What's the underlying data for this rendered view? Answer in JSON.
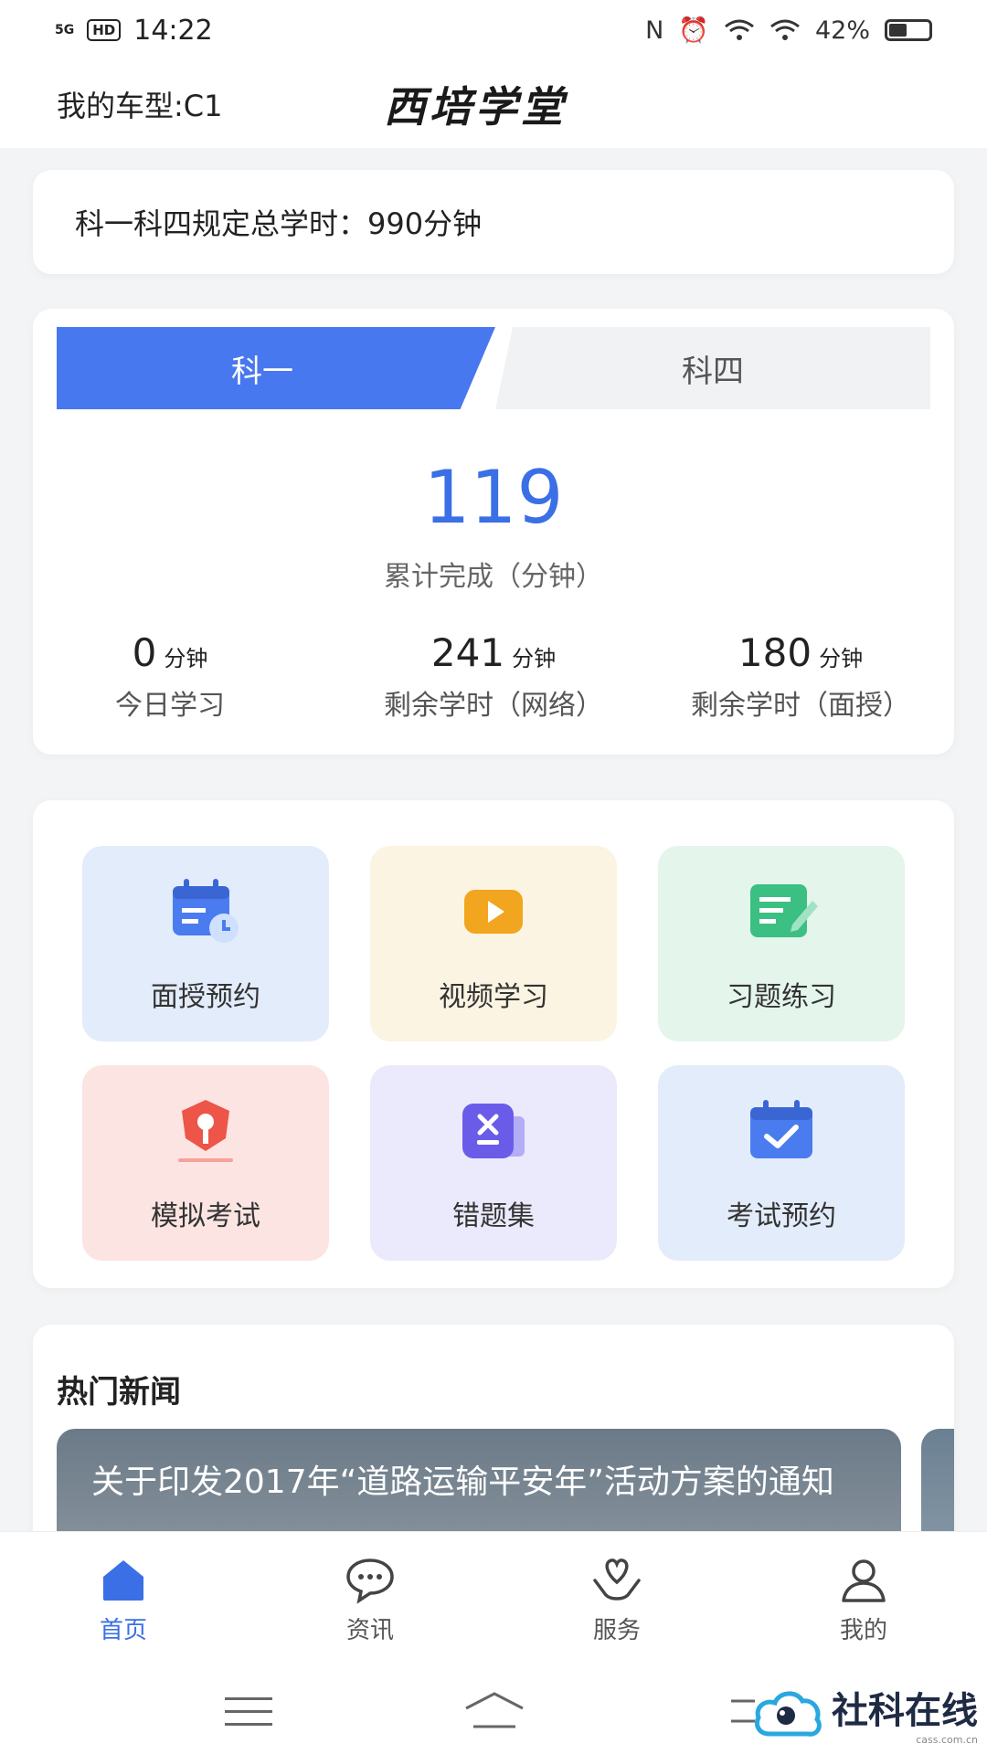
{
  "status": {
    "time": "14:22",
    "network": "5G",
    "hd": "HD",
    "battery": "42%",
    "battery_level": 0.42
  },
  "header": {
    "car_type": "我的车型:C1",
    "brand": "西培学堂"
  },
  "total": {
    "text": "科一科四规定总学时：990分钟"
  },
  "subjects": {
    "tab1": "科一",
    "tab2": "科四"
  },
  "progress": {
    "completed": "119",
    "completed_label": "累计完成（分钟）",
    "stats": [
      {
        "value": "0",
        "unit": "分钟",
        "label": "今日学习"
      },
      {
        "value": "241",
        "unit": "分钟",
        "label": "剩余学时（网络）"
      },
      {
        "value": "180",
        "unit": "分钟",
        "label": "剩余学时（面授）"
      }
    ]
  },
  "features": [
    {
      "label": "面授预约",
      "icon": "calendar-clock-icon",
      "color": "#4a7cf0",
      "bg": "#e3ecfb"
    },
    {
      "label": "视频学习",
      "icon": "video-play-icon",
      "color": "#f2a51e",
      "bg": "#fcf4e2"
    },
    {
      "label": "习题练习",
      "icon": "edit-note-icon",
      "color": "#3cbf82",
      "bg": "#e4f5ec"
    },
    {
      "label": "模拟考试",
      "icon": "exam-badge-icon",
      "color": "#ec5548",
      "bg": "#fbe4e2"
    },
    {
      "label": "错题集",
      "icon": "wrong-set-icon",
      "color": "#6a5ce8",
      "bg": "#ebeafc"
    },
    {
      "label": "考试预约",
      "icon": "calendar-check-icon",
      "color": "#4a7cf0",
      "bg": "#e3ecfb"
    }
  ],
  "news": {
    "title": "热门新闻",
    "headline": "关于印发2017年“道路运输平安年”活动方案的通知"
  },
  "tabbar": [
    {
      "label": "首页",
      "icon": "home-icon",
      "active": true
    },
    {
      "label": "资讯",
      "icon": "chat-icon",
      "active": false
    },
    {
      "label": "服务",
      "icon": "heart-hand-icon",
      "active": false
    },
    {
      "label": "我的",
      "icon": "user-icon",
      "active": false
    }
  ],
  "watermark": {
    "text": "社科在线",
    "sub": "cass.com.cn"
  },
  "colors": {
    "accent": "#3a6fe6",
    "tab_active": "#4878f0"
  }
}
